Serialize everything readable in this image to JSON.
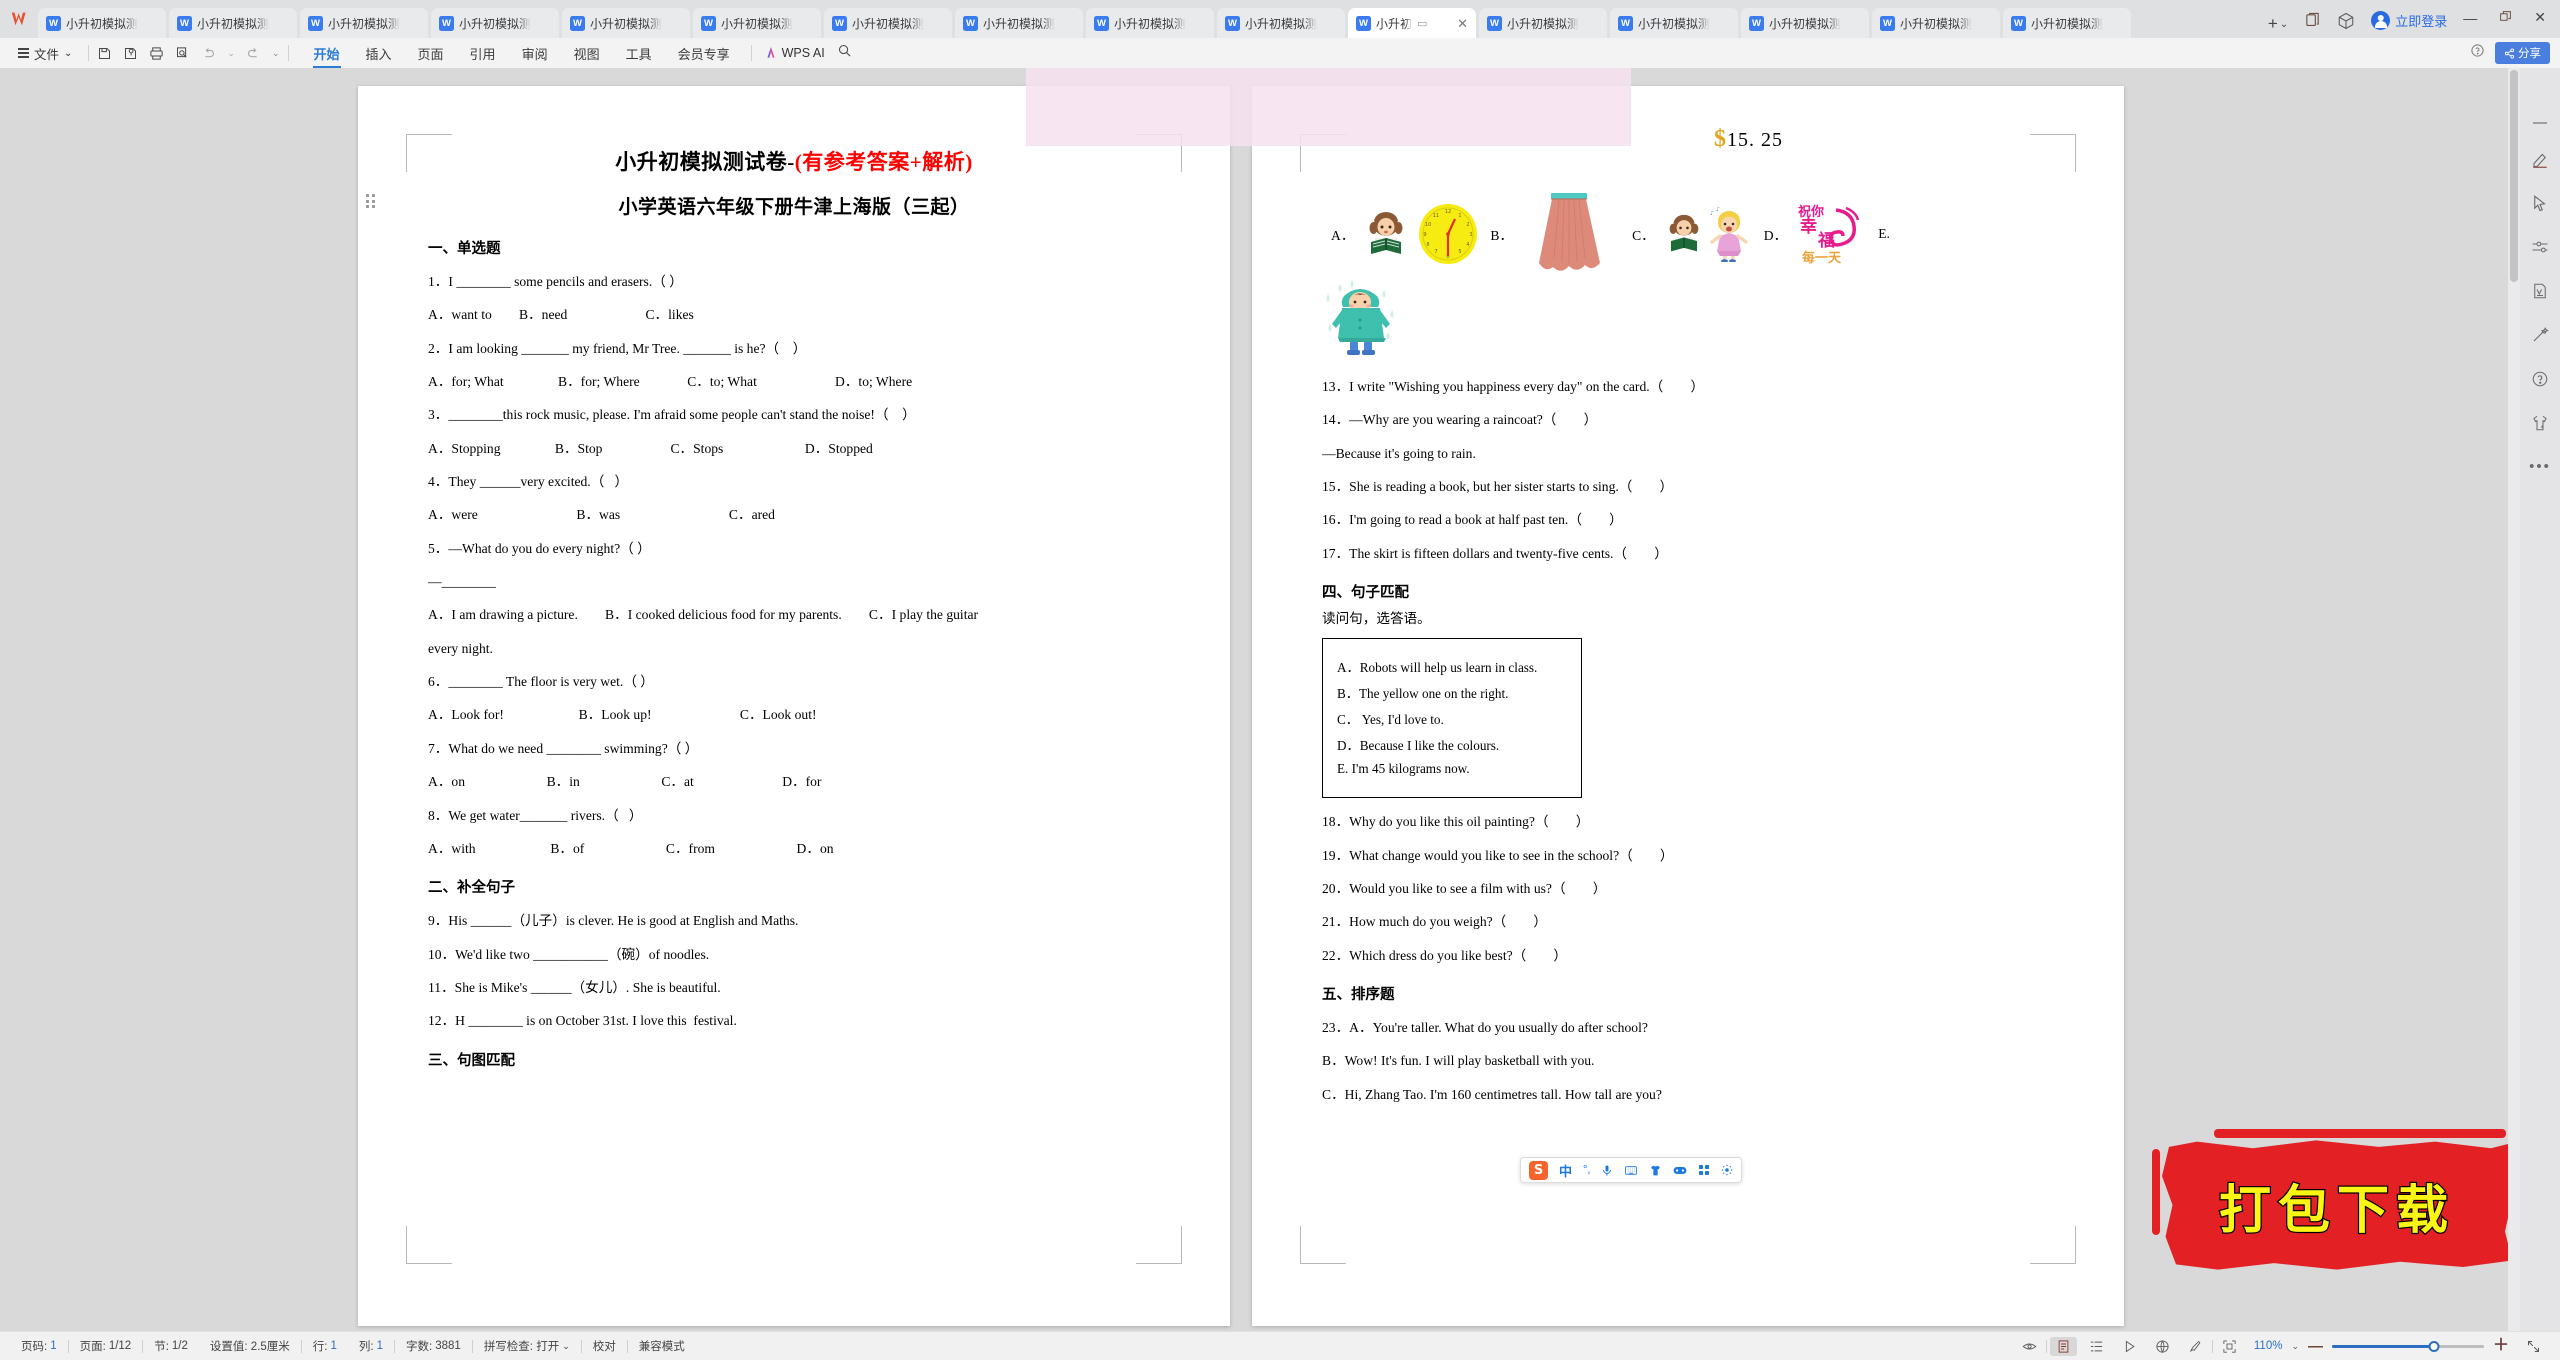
{
  "tabbar": {
    "tabs": [
      {
        "label": "小升初模拟测",
        "active": false
      },
      {
        "label": "小升初模拟测",
        "active": false
      },
      {
        "label": "小升初模拟测",
        "active": false
      },
      {
        "label": "小升初模拟测",
        "active": false
      },
      {
        "label": "小升初模拟测",
        "active": false
      },
      {
        "label": "小升初模拟测",
        "active": false
      },
      {
        "label": "小升初模拟测",
        "active": false
      },
      {
        "label": "小升初模拟测",
        "active": false
      },
      {
        "label": "小升初模拟测",
        "active": false
      },
      {
        "label": "小升初模拟测",
        "active": false
      },
      {
        "label": "小升初",
        "active": true
      },
      {
        "label": "小升初模拟测",
        "active": false
      },
      {
        "label": "小升初模拟测",
        "active": false
      },
      {
        "label": "小升初模拟测",
        "active": false
      },
      {
        "label": "小升初模拟测",
        "active": false
      },
      {
        "label": "小升初模拟测",
        "active": false
      }
    ],
    "new_tab": "+",
    "tab_list_caret": "⌄",
    "login_label": "立即登录",
    "minimize": "—",
    "restore": "❐",
    "close": "✕"
  },
  "ribbon": {
    "file_label": "文件",
    "file_caret": "⌄",
    "menus": [
      {
        "label": "开始",
        "active": true
      },
      {
        "label": "插入",
        "active": false
      },
      {
        "label": "页面",
        "active": false
      },
      {
        "label": "引用",
        "active": false
      },
      {
        "label": "审阅",
        "active": false
      },
      {
        "label": "视图",
        "active": false
      },
      {
        "label": "工具",
        "active": false
      },
      {
        "label": "会员专享",
        "active": false
      }
    ],
    "wps_ai": "WPS AI",
    "share_label": "分享"
  },
  "document": {
    "title_black": "小升初模拟测试卷-",
    "title_red": "(有参考答案+解析)",
    "subtitle": "小学英语六年级下册牛津上海版（三起）",
    "page1": {
      "section1": "一、单选题",
      "items": [
        "1．I ________ some pencils and erasers.（ ）",
        "A．want to        B．need                       C．likes",
        "2．I am looking _______ my friend, Mr Tree. _______ is he?（    ）",
        "A．for; What                B．for; Where              C．to; What                       D．to; Where",
        "3．________this rock music, please. I'm afraid some people can't stand the noise!（    ）",
        "A．Stopping                B．Stop                    C．Stops                        D．Stopped",
        "4．They ______very excited.（   ）",
        "A．were                             B．was                                C．ared",
        "5．—What do you do every night?（ ）",
        "—________",
        "A．I am drawing a picture.        B．I cooked delicious food for my parents.        C．I play the guitar",
        "every night.",
        "6．________ The floor is very wet.（ ）",
        "A．Look for!                      B．Look up!                          C．Look out!",
        "7．What do we need ________ swimming?（ ）",
        "A．on                        B．in                        C．at                          D．for",
        "8．We get water_______ rivers.（   ）",
        "A．with                      B．of                        C．from                        D．on"
      ],
      "section2": "二、补全句子",
      "items2": [
        "9．His ______（儿子）is clever. He is good at English and Maths.",
        "10．We'd like two ___________（碗）of noodles.",
        "11．She is Mike's ______（女儿）. She is beautiful.",
        "12．H ________ is on October 31st. I love this  festival."
      ],
      "section3": "三、句图匹配"
    },
    "page2": {
      "price_currency": "$",
      "price_value": "15. 25",
      "pic_labels": [
        "A．",
        "B．",
        "C．",
        "D．",
        "E."
      ],
      "items": [
        "13．I write \"Wishing you happiness every day\" on the card.（        ）",
        "14．—Why are you wearing a raincoat?（        ）",
        "—Because it's going to rain.",
        "15．She is reading a book, but her sister starts to sing.（        ）",
        "16．I'm going to read a book at half past ten.（        ）",
        "17．The skirt is fifteen dollars and twenty-five cents.（        ）"
      ],
      "section4": "四、句子匹配",
      "section4_hint": "读问句，选答语。",
      "matchbox": [
        "A．Robots will help us learn in class.",
        "B．The yellow one on the right.",
        "C．  Yes, I'd love to.",
        "D．Because I like the colours.",
        "E. I'm 45 kilograms now."
      ],
      "items2": [
        "18．Why do you like this oil painting?（        ）",
        "19．What change would you like to see in the school?（        ）",
        "20．Would you like to see a film with us?（        ）",
        "21．How much do you weigh?（        ）",
        "22．Which dress do you like best?（        ）"
      ],
      "section5": "五、排序题",
      "items3": [
        "23．A．You're taller. What do you usually do after school?",
        "B．Wow! It's fun. I will play basketball with you.",
        "C．Hi, Zhang Tao. I'm 160 centimetres tall. How tall are you?"
      ],
      "wish_stamp_top": "祝你",
      "wish_stamp_mid": "幸福",
      "wish_stamp_bottom": "每一天"
    }
  },
  "watermark": {
    "text": "打包下载"
  },
  "statusbar": {
    "page_no_label": "页码:",
    "page_no": "1",
    "page_label": "页面:",
    "page": "1/12",
    "section_label": "节:",
    "section": "1/2",
    "setting": "设置值: 2.5厘米",
    "row_label": "行:",
    "row": "1",
    "col_label": "列:",
    "col": "1",
    "words_label": "字数:",
    "words": "3881",
    "spellcheck": "拼写检查: 打开",
    "proof": "校对",
    "compat": "兼容模式",
    "zoom": "110%"
  }
}
